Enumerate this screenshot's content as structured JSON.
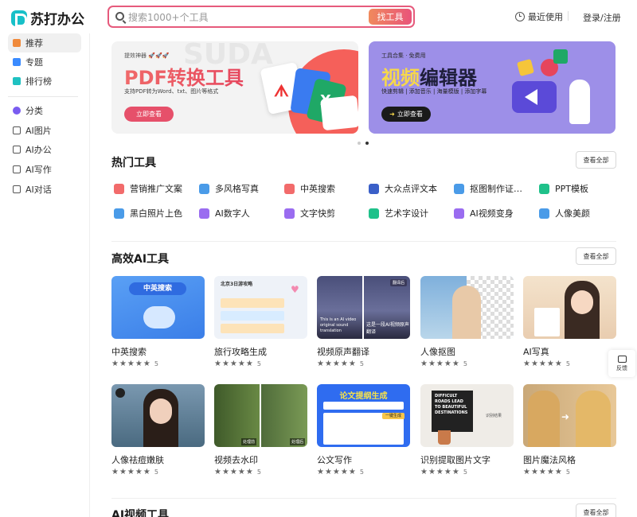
{
  "header": {
    "logo_text": "苏打办公",
    "search_placeholder": "搜索1000+个工具",
    "search_button": "找工具",
    "recent": "最近使用",
    "login": "登录/注册"
  },
  "sidebar": {
    "items": [
      {
        "label": "推荐",
        "icon": "recommend-icon",
        "color": "#f08a3c"
      },
      {
        "label": "专题",
        "icon": "topic-icon",
        "color": "#3a8bff"
      },
      {
        "label": "排行榜",
        "icon": "ranking-icon",
        "color": "#1fc1c1"
      },
      {
        "label": "分类",
        "icon": "category-icon",
        "color": "#7a5cf0"
      },
      {
        "label": "AI图片",
        "icon": "ai-image-icon",
        "color": "#555555"
      },
      {
        "label": "AI办公",
        "icon": "ai-office-icon",
        "color": "#555555"
      },
      {
        "label": "AI写作",
        "icon": "ai-writing-icon",
        "color": "#555555"
      },
      {
        "label": "AI对话",
        "icon": "ai-chat-icon",
        "color": "#555555"
      }
    ]
  },
  "banners": [
    {
      "small": "提效神器 🚀🚀🚀",
      "title": "PDF转换工具",
      "subtitle": "支持PDF转为Word、txt、图片等格式",
      "button": "立即查看",
      "watermark": "SUDA"
    },
    {
      "small": "工具合集 · 免费用",
      "title": "视频编辑器",
      "subtitle": "快速剪辑 | 添加音乐 | 海量模版 | 添加字幕",
      "button": "立即查看"
    }
  ],
  "hot": {
    "title": "热门工具",
    "see_all": "查看全部",
    "items": [
      {
        "label": "营销推广文案",
        "icon": "pdf-doc-icon",
        "color": "#f26b6b"
      },
      {
        "label": "多风格写真",
        "icon": "image-icon",
        "color": "#4a9be8"
      },
      {
        "label": "中英搜索",
        "icon": "pdf-doc-icon",
        "color": "#f26b6b"
      },
      {
        "label": "大众点评文本",
        "icon": "word-doc-icon",
        "color": "#3a5fc8"
      },
      {
        "label": "抠图制作证…",
        "icon": "image-icon",
        "color": "#4a9be8"
      },
      {
        "label": "PPT模板",
        "icon": "ppt-icon",
        "color": "#1fc18a"
      },
      {
        "label": "黑白照片上色",
        "icon": "image-icon",
        "color": "#4a9be8"
      },
      {
        "label": "AI数字人",
        "icon": "video-icon",
        "color": "#9a6cf0"
      },
      {
        "label": "文字快剪",
        "icon": "video-icon",
        "color": "#9a6cf0"
      },
      {
        "label": "艺术字设计",
        "icon": "ppt-icon",
        "color": "#1fc18a"
      },
      {
        "label": "AI视频变身",
        "icon": "video-icon",
        "color": "#9a6cf0"
      },
      {
        "label": "人像美颜",
        "icon": "image-icon",
        "color": "#4a9be8"
      }
    ]
  },
  "ai_tools": {
    "title": "高效AI工具",
    "see_all": "查看全部",
    "cards": [
      {
        "title": "中英搜索",
        "score": "5",
        "img_text": "中英搜索",
        "bg": "#4a8ff0"
      },
      {
        "title": "旅行攻略生成",
        "score": "5",
        "img_text": "北京3日游攻略",
        "bg": "#eef2f8"
      },
      {
        "title": "视频原声翻译",
        "score": "5",
        "img_text": "This is an AI video original sound translation",
        "bg": "#3a3a5a"
      },
      {
        "title": "人像抠图",
        "score": "5",
        "img_text": "",
        "bg": "#8fb6d8"
      },
      {
        "title": "AI写真",
        "score": "5",
        "img_text": "",
        "bg": "#f1dcc4"
      },
      {
        "title": "人像祛痘嫩肤",
        "score": "5",
        "img_text": "",
        "bg": "#5f7f9a"
      },
      {
        "title": "视频去水印",
        "score": "5",
        "img_text": "处理前  处理后",
        "bg": "#4f6b3a"
      },
      {
        "title": "公文写作",
        "score": "5",
        "img_text": "论文提纲生成",
        "bg": "#2f6cf0"
      },
      {
        "title": "识别提取图片文字",
        "score": "5",
        "img_text": "DIFFICULT ROADS LEAD TO BEAUTIFUL DESTINATIONS",
        "bg": "#e8e4de"
      },
      {
        "title": "图片魔法风格",
        "score": "5",
        "img_text": "",
        "bg": "#d8b890"
      }
    ]
  },
  "video_tools": {
    "title": "AI视频工具",
    "see_all": "查看全部"
  },
  "feedback": {
    "label": "反馈"
  }
}
